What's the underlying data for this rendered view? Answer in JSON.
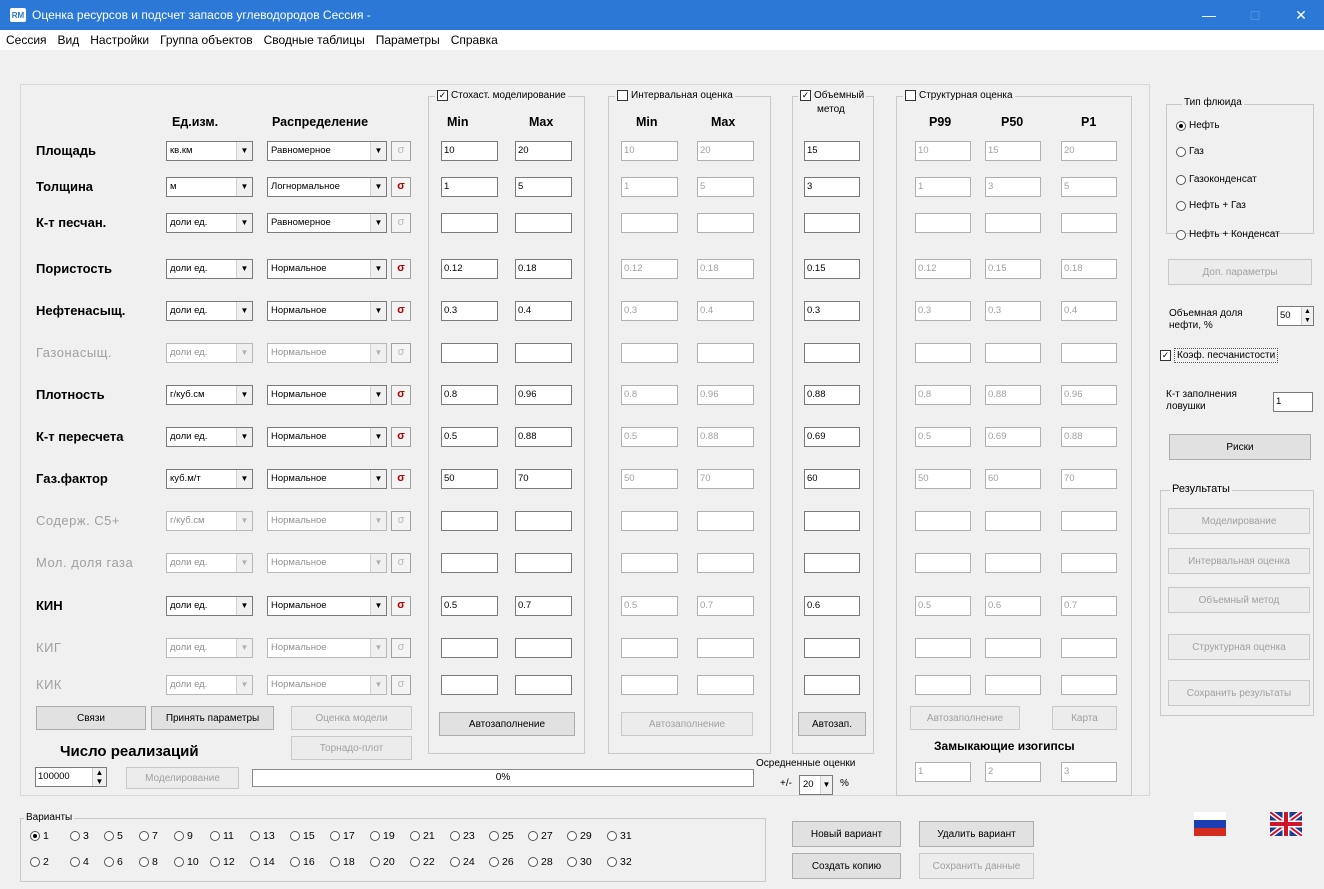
{
  "window": {
    "title": "Оценка ресурсов и подсчет запасов углеводородов    Сессия -",
    "app_icon": "RM"
  },
  "menu": [
    "Сессия",
    "Вид",
    "Настройки",
    "Группа объектов",
    "Сводные таблицы",
    "Параметры",
    "Справка"
  ],
  "headers": {
    "unit": "Ед.изм.",
    "dist": "Распределение",
    "min": "Min",
    "max": "Max",
    "imin": "Min",
    "imax": "Max",
    "p99": "P99",
    "p50": "P50",
    "p1": "P1"
  },
  "groups": {
    "stoch": "Стохаст. моделирование",
    "interval": "Интервальная оценка",
    "volume_1": "Объемный",
    "volume_2": "метод",
    "struct": "Структурная оценка"
  },
  "rows": [
    {
      "label": "Площадь",
      "unit": "кв.км",
      "dist": "Равномерное",
      "sig": "σ",
      "min": "10",
      "max": "20",
      "imin": "10",
      "imax": "20",
      "vol": "15",
      "p99": "10",
      "p50": "15",
      "p1": "20"
    },
    {
      "label": "Толщина",
      "unit": "м",
      "dist": "Логнормальное",
      "sig": "σ",
      "min": "1",
      "max": "5",
      "imin": "1",
      "imax": "5",
      "vol": "3",
      "p99": "1",
      "p50": "3",
      "p1": "5"
    },
    {
      "label": "К-т песчан.",
      "unit": "доли ед.",
      "dist": "Равномерное",
      "sig": "σ",
      "min": "",
      "max": "",
      "imin": "",
      "imax": "",
      "vol": "",
      "p99": "",
      "p50": "",
      "p1": ""
    },
    {
      "label": "Пористость",
      "unit": "доли ед.",
      "dist": "Нормальное",
      "sig": "σ",
      "min": "0.12",
      "max": "0.18",
      "imin": "0.12",
      "imax": "0.18",
      "vol": "0.15",
      "p99": "0.12",
      "p50": "0.15",
      "p1": "0.18"
    },
    {
      "label": "Нефтенасыщ.",
      "unit": "доли ед.",
      "dist": "Нормальное",
      "sig": "σ",
      "min": "0.3",
      "max": "0.4",
      "imin": "0.3",
      "imax": "0.4",
      "vol": "0.3",
      "p99": "0.3",
      "p50": "0.3",
      "p1": "0.4"
    },
    {
      "label": "Газонасыщ.",
      "unit": "доли ед.",
      "dist": "Нормальное",
      "sig": "σ",
      "min": "",
      "max": "",
      "imin": "",
      "imax": "",
      "vol": "",
      "p99": "",
      "p50": "",
      "p1": ""
    },
    {
      "label": "Плотность",
      "unit": "г/куб.см",
      "dist": "Нормальное",
      "sig": "σ",
      "min": "0.8",
      "max": "0.96",
      "imin": "0.8",
      "imax": "0.96",
      "vol": "0.88",
      "p99": "0.8",
      "p50": "0.88",
      "p1": "0.96"
    },
    {
      "label": "К-т пересчета",
      "unit": "доли ед.",
      "dist": "Нормальное",
      "sig": "σ",
      "min": "0.5",
      "max": "0.88",
      "imin": "0.5",
      "imax": "0.88",
      "vol": "0.69",
      "p99": "0.5",
      "p50": "0.69",
      "p1": "0.88"
    },
    {
      "label": "Газ.фактор",
      "unit": "куб.м/т",
      "dist": "Нормальное",
      "sig": "σ",
      "min": "50",
      "max": "70",
      "imin": "50",
      "imax": "70",
      "vol": "60",
      "p99": "50",
      "p50": "60",
      "p1": "70"
    },
    {
      "label": "Содерж. С5+",
      "unit": "г/куб.см",
      "dist": "Нормальное",
      "sig": "σ",
      "min": "",
      "max": "",
      "imin": "",
      "imax": "",
      "vol": "",
      "p99": "",
      "p50": "",
      "p1": ""
    },
    {
      "label": "Мол. доля газа",
      "unit": "доли ед.",
      "dist": "Нормальное",
      "sig": "σ",
      "min": "",
      "max": "",
      "imin": "",
      "imax": "",
      "vol": "",
      "p99": "",
      "p50": "",
      "p1": ""
    },
    {
      "label": "КИН",
      "unit": "доли ед.",
      "dist": "Нормальное",
      "sig": "σ",
      "min": "0.5",
      "max": "0.7",
      "imin": "0.5",
      "imax": "0.7",
      "vol": "0.6",
      "p99": "0.5",
      "p50": "0.6",
      "p1": "0.7"
    },
    {
      "label": "КИГ",
      "unit": "доли ед.",
      "dist": "Нормальное",
      "sig": "σ",
      "min": "",
      "max": "",
      "imin": "",
      "imax": "",
      "vol": "",
      "p99": "",
      "p50": "",
      "p1": ""
    },
    {
      "label": "КИК",
      "unit": "доли ед.",
      "dist": "Нормальное",
      "sig": "σ",
      "min": "",
      "max": "",
      "imin": "",
      "imax": "",
      "vol": "",
      "p99": "",
      "p50": "",
      "p1": ""
    }
  ],
  "buttons": {
    "links": "Связи",
    "accept": "Принять параметры",
    "model_eval": "Оценка модели",
    "tornado": "Торнадо-плот",
    "modeling": "Моделирование",
    "autofill_stoch": "Автозаполнение",
    "autofill_interval": "Автозаполнение",
    "autofill_vol": "Автозап.",
    "autofill_struct": "Автозаполнение",
    "map": "Карта",
    "new_variant": "Новый вариант",
    "delete_variant": "Удалить вариант",
    "copy": "Создать копию",
    "save_data": "Сохранить данные"
  },
  "realizations": {
    "label": "Число реализаций",
    "value": "100000"
  },
  "progress": {
    "text": "0%",
    "value": 0
  },
  "averaged": {
    "label": "Осредненные оценки",
    "pm": "+/-",
    "value": "20",
    "unit": "%"
  },
  "isolines": {
    "label": "Замыкающие изогипсы",
    "v1": "1",
    "v2": "2",
    "v3": "3"
  },
  "fluid": {
    "title": "Тип флюида",
    "options": [
      "Нефть",
      "Газ",
      "Газоконденсат",
      "Нефть + Газ",
      "Нефть + Конденсат"
    ],
    "selected": 0
  },
  "side": {
    "extra_params": "Доп. параметры",
    "oil_share_label_1": "Объемная доля",
    "oil_share_label_2": "нефти, %",
    "oil_share_value": "50",
    "sand_coef": "Коэф. песчанистости",
    "trap_fill_1": "К-т заполнения",
    "trap_fill_2": "ловушки",
    "trap_fill_value": "1",
    "risks": "Риски"
  },
  "results": {
    "title": "Результаты",
    "items": [
      "Моделирование",
      "Интервальная оценка",
      "Объемный метод",
      "Структурная оценка",
      "Сохранить результаты"
    ]
  },
  "variants": {
    "title": "Варианты",
    "top": [
      "1",
      "3",
      "5",
      "7",
      "9",
      "11",
      "13",
      "15",
      "17",
      "19",
      "21",
      "23",
      "25",
      "27",
      "29",
      "31"
    ],
    "bottom": [
      "2",
      "4",
      "6",
      "8",
      "10",
      "12",
      "14",
      "16",
      "18",
      "20",
      "22",
      "24",
      "26",
      "28",
      "30",
      "32"
    ],
    "selected": "1"
  },
  "flags": [
    "russian-flag",
    "uk-flag"
  ]
}
